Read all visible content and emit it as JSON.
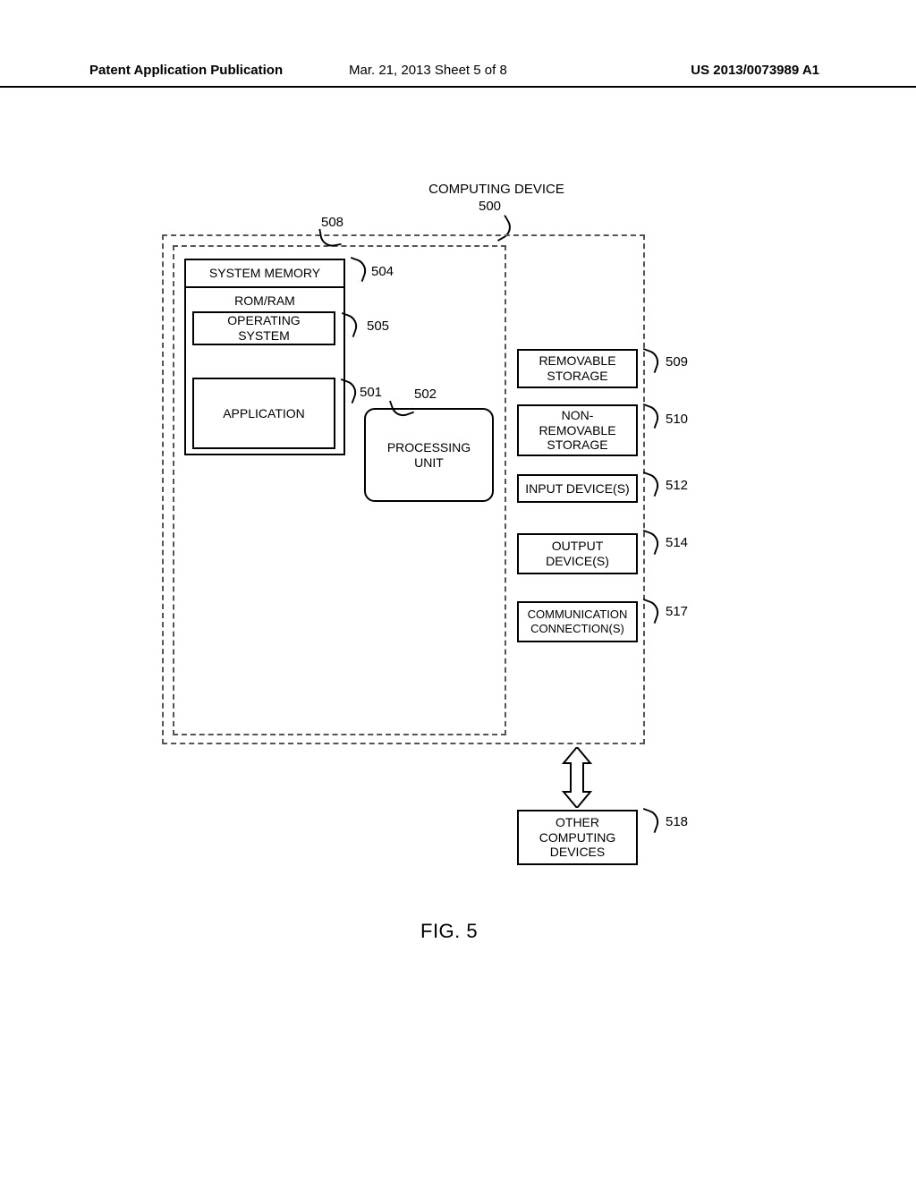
{
  "header": {
    "left": "Patent Application Publication",
    "middle": "Mar. 21, 2013  Sheet 5 of 8",
    "right": "US 2013/0073989 A1"
  },
  "diagram": {
    "title": "COMPUTING DEVICE",
    "title_ref": "500",
    "ref_508": "508",
    "system_memory": {
      "header": "SYSTEM MEMORY",
      "sub": "ROM/RAM",
      "ref": "504",
      "operating_system": {
        "label": "OPERATING\nSYSTEM",
        "ref": "505"
      },
      "application": {
        "label": "APPLICATION",
        "ref": "501"
      }
    },
    "processing_unit": {
      "label": "PROCESSING\nUNIT",
      "ref": "502"
    },
    "removable": {
      "label": "REMOVABLE\nSTORAGE",
      "ref": "509"
    },
    "nonremovable": {
      "label": "NON-\nREMOVABLE\nSTORAGE",
      "ref": "510"
    },
    "input": {
      "label": "INPUT DEVICE(S)",
      "ref": "512"
    },
    "output": {
      "label": "OUTPUT\nDEVICE(S)",
      "ref": "514"
    },
    "comm": {
      "label": "COMMUNICATION\nCONNECTION(S)",
      "ref": "517"
    },
    "other": {
      "label": "OTHER\nCOMPUTING\nDEVICES",
      "ref": "518"
    }
  },
  "figure_caption": "FIG. 5"
}
